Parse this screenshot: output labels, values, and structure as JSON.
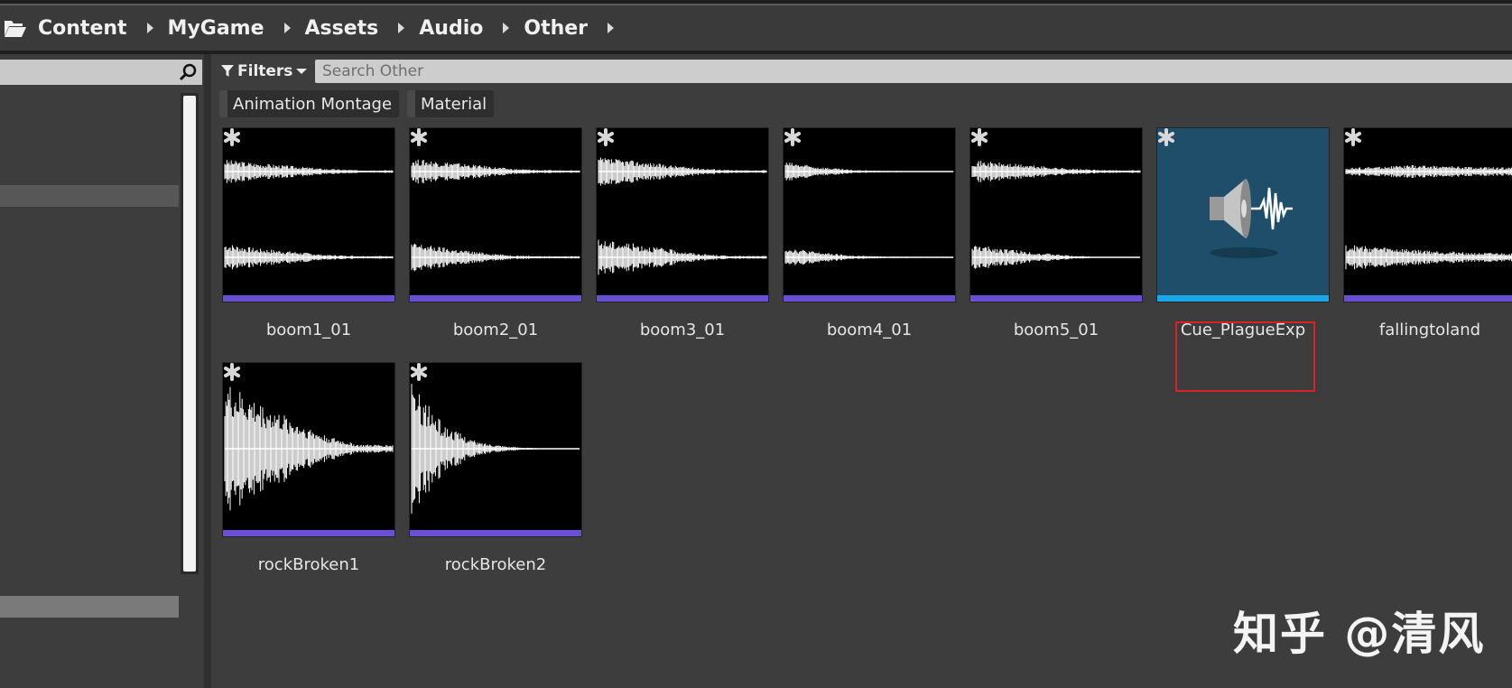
{
  "breadcrumb": {
    "items": [
      "Content",
      "MyGame",
      "Assets",
      "Audio",
      "Other"
    ]
  },
  "filter_bar": {
    "filters_label": "Filters",
    "search_placeholder": "Search Other",
    "chips": [
      "Animation Montage",
      "Material"
    ]
  },
  "assets": [
    {
      "name": "boom1_01",
      "kind": "sound-wave"
    },
    {
      "name": "boom2_01",
      "kind": "sound-wave"
    },
    {
      "name": "boom3_01",
      "kind": "sound-wave"
    },
    {
      "name": "boom4_01",
      "kind": "sound-wave"
    },
    {
      "name": "boom5_01",
      "kind": "sound-wave"
    },
    {
      "name": "Cue_PlagueExp",
      "kind": "sound-cue"
    },
    {
      "name": "fallingtoland",
      "kind": "sound-wave"
    },
    {
      "name": "rockBroken1",
      "kind": "sound-wave"
    },
    {
      "name": "rockBroken2",
      "kind": "sound-wave"
    }
  ],
  "watermark": "知乎 @清风",
  "colors": {
    "sound_wave_bar": "#6a4fd4",
    "sound_cue_bar": "#1aa7e8",
    "highlight_box": "#d6232a",
    "cue_background": "#1f4e6a"
  }
}
